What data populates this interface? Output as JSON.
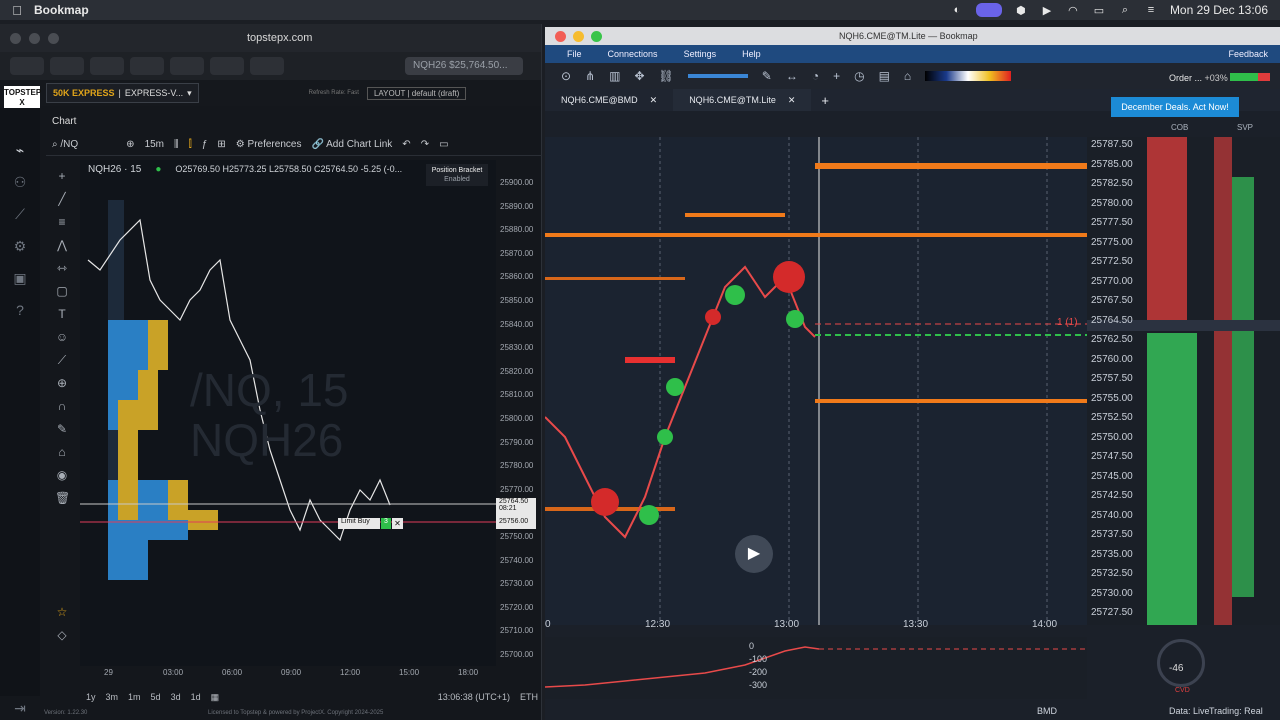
{
  "menubar": {
    "app": "Bookmap",
    "datetime": "Mon 29 Dec 13:06"
  },
  "left_window": {
    "url": "topstepx.com",
    "browser_tab": "NQH26 $25,764.50...",
    "account": {
      "name": "50K EXPRESS",
      "sep": " | ",
      "mode": "EXPRESS-V...",
      "refresh": "Refresh Rate: Fast",
      "layout": "LAYOUT | default (draft)"
    },
    "logo": "TOPSTEP X",
    "chart_tab": "Chart",
    "symbol": "/NQ",
    "interval": "15m",
    "preferences": "Preferences",
    "add_chart_link": "Add Chart Link",
    "title": "NQH26 · 15",
    "ohlc": "O25769.50  H25773.25  L25758.50  C25764.50  -5.25 (-0...",
    "watermark_line1": "/NQ, 15",
    "watermark_line2": "NQH26",
    "position_bracket": "Position Bracket",
    "position_bracket_status": "Enabled",
    "y_ticks": [
      "25900.00",
      "25890.00",
      "25880.00",
      "25870.00",
      "25860.00",
      "25850.00",
      "25840.00",
      "25830.00",
      "25820.00",
      "25810.00",
      "25800.00",
      "25790.00",
      "25780.00",
      "25770.00",
      "25760.00",
      "25750.00",
      "25740.00",
      "25730.00",
      "25720.00",
      "25710.00",
      "25700.00"
    ],
    "last_price": "25764.50",
    "last_time": "08:21",
    "limit_price": "25756.00",
    "limit_label": "Limit Buy",
    "limit_qty": "3",
    "x_ticks": [
      "29",
      "03:00",
      "06:00",
      "09:00",
      "12:00",
      "15:00",
      "18:00"
    ],
    "ranges": [
      "1y",
      "3m",
      "1m",
      "5d",
      "3d",
      "1d"
    ],
    "clock": "13:06:38 (UTC+1)",
    "session": "ETH",
    "version": "Version: 1.22.30",
    "license": "Licensed to Topstep & powered by ProjectX. Copyright 2024-2025"
  },
  "right_window": {
    "title": "NQH6.CME@TM.Lite  —  Bookmap",
    "menu": [
      "File",
      "Connections",
      "Settings",
      "Help"
    ],
    "feedback": "Feedback",
    "order_label": "Order ...",
    "order_pct": "+03%",
    "tabs": [
      {
        "label": "NQH6.CME@BMD"
      },
      {
        "label": "NQH6.CME@TM.Lite"
      }
    ],
    "deal_banner": "December Deals. Act Now!",
    "cob": "COB",
    "svp": "SVP",
    "prices": [
      "25787.50",
      "25785.00",
      "25782.50",
      "25780.00",
      "25777.50",
      "25775.00",
      "25772.50",
      "25770.00",
      "25767.50",
      "25764.50",
      "25762.50",
      "25760.00",
      "25757.50",
      "25755.00",
      "25752.50",
      "25750.00",
      "25747.50",
      "25745.00",
      "25742.50",
      "25740.00",
      "25737.50",
      "25735.00",
      "25732.50",
      "25730.00",
      "25727.50"
    ],
    "position_marker": "1 (1)",
    "time_ticks": [
      "0",
      "12:30",
      "13:00",
      "13:30",
      "14:00"
    ],
    "cvd_ticks": [
      "0",
      "-100",
      "-200",
      "-300"
    ],
    "cvd_value": "-46",
    "cvd_label": "CVD",
    "status_bmd": "BMD",
    "status_data": "Data: Live",
    "status_trading": "Trading: Real"
  }
}
